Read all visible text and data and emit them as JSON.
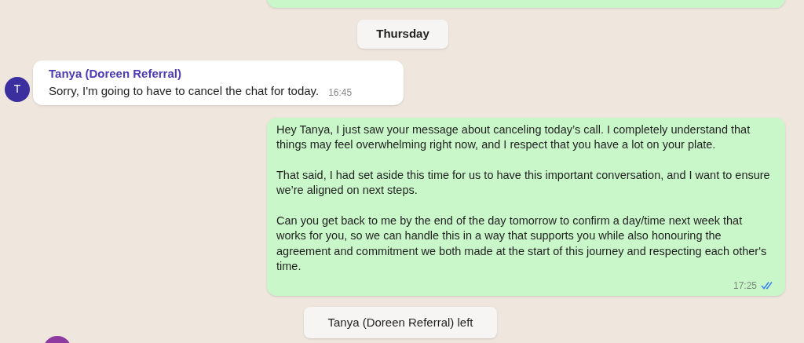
{
  "date_divider": "Thursday",
  "incoming": {
    "sender": "Tanya (Doreen Referral)",
    "avatar_initial": "T",
    "text": "Sorry, I'm going to have to cancel the chat for today.",
    "time": "16:45"
  },
  "outgoing": {
    "paragraphs": [
      "Hey Tanya, I just saw your message about canceling today’s call. I completely understand that things may feel overwhelming right now, and I respect that you have a lot on your plate.",
      "That said, I had set aside this time for us to have this important conversation, and I want to ensure we’re aligned on next steps.",
      "Can you get back to me by the end of the day tomorrow to confirm a day/time next week that works for you, so we can handle this in a way that supports you while also honouring the agreement and commitment we both made at the start of this journey and respecting each other's time."
    ],
    "time": "17:25",
    "read": true
  },
  "system_notice": "Tanya (Doreen Referral) left"
}
